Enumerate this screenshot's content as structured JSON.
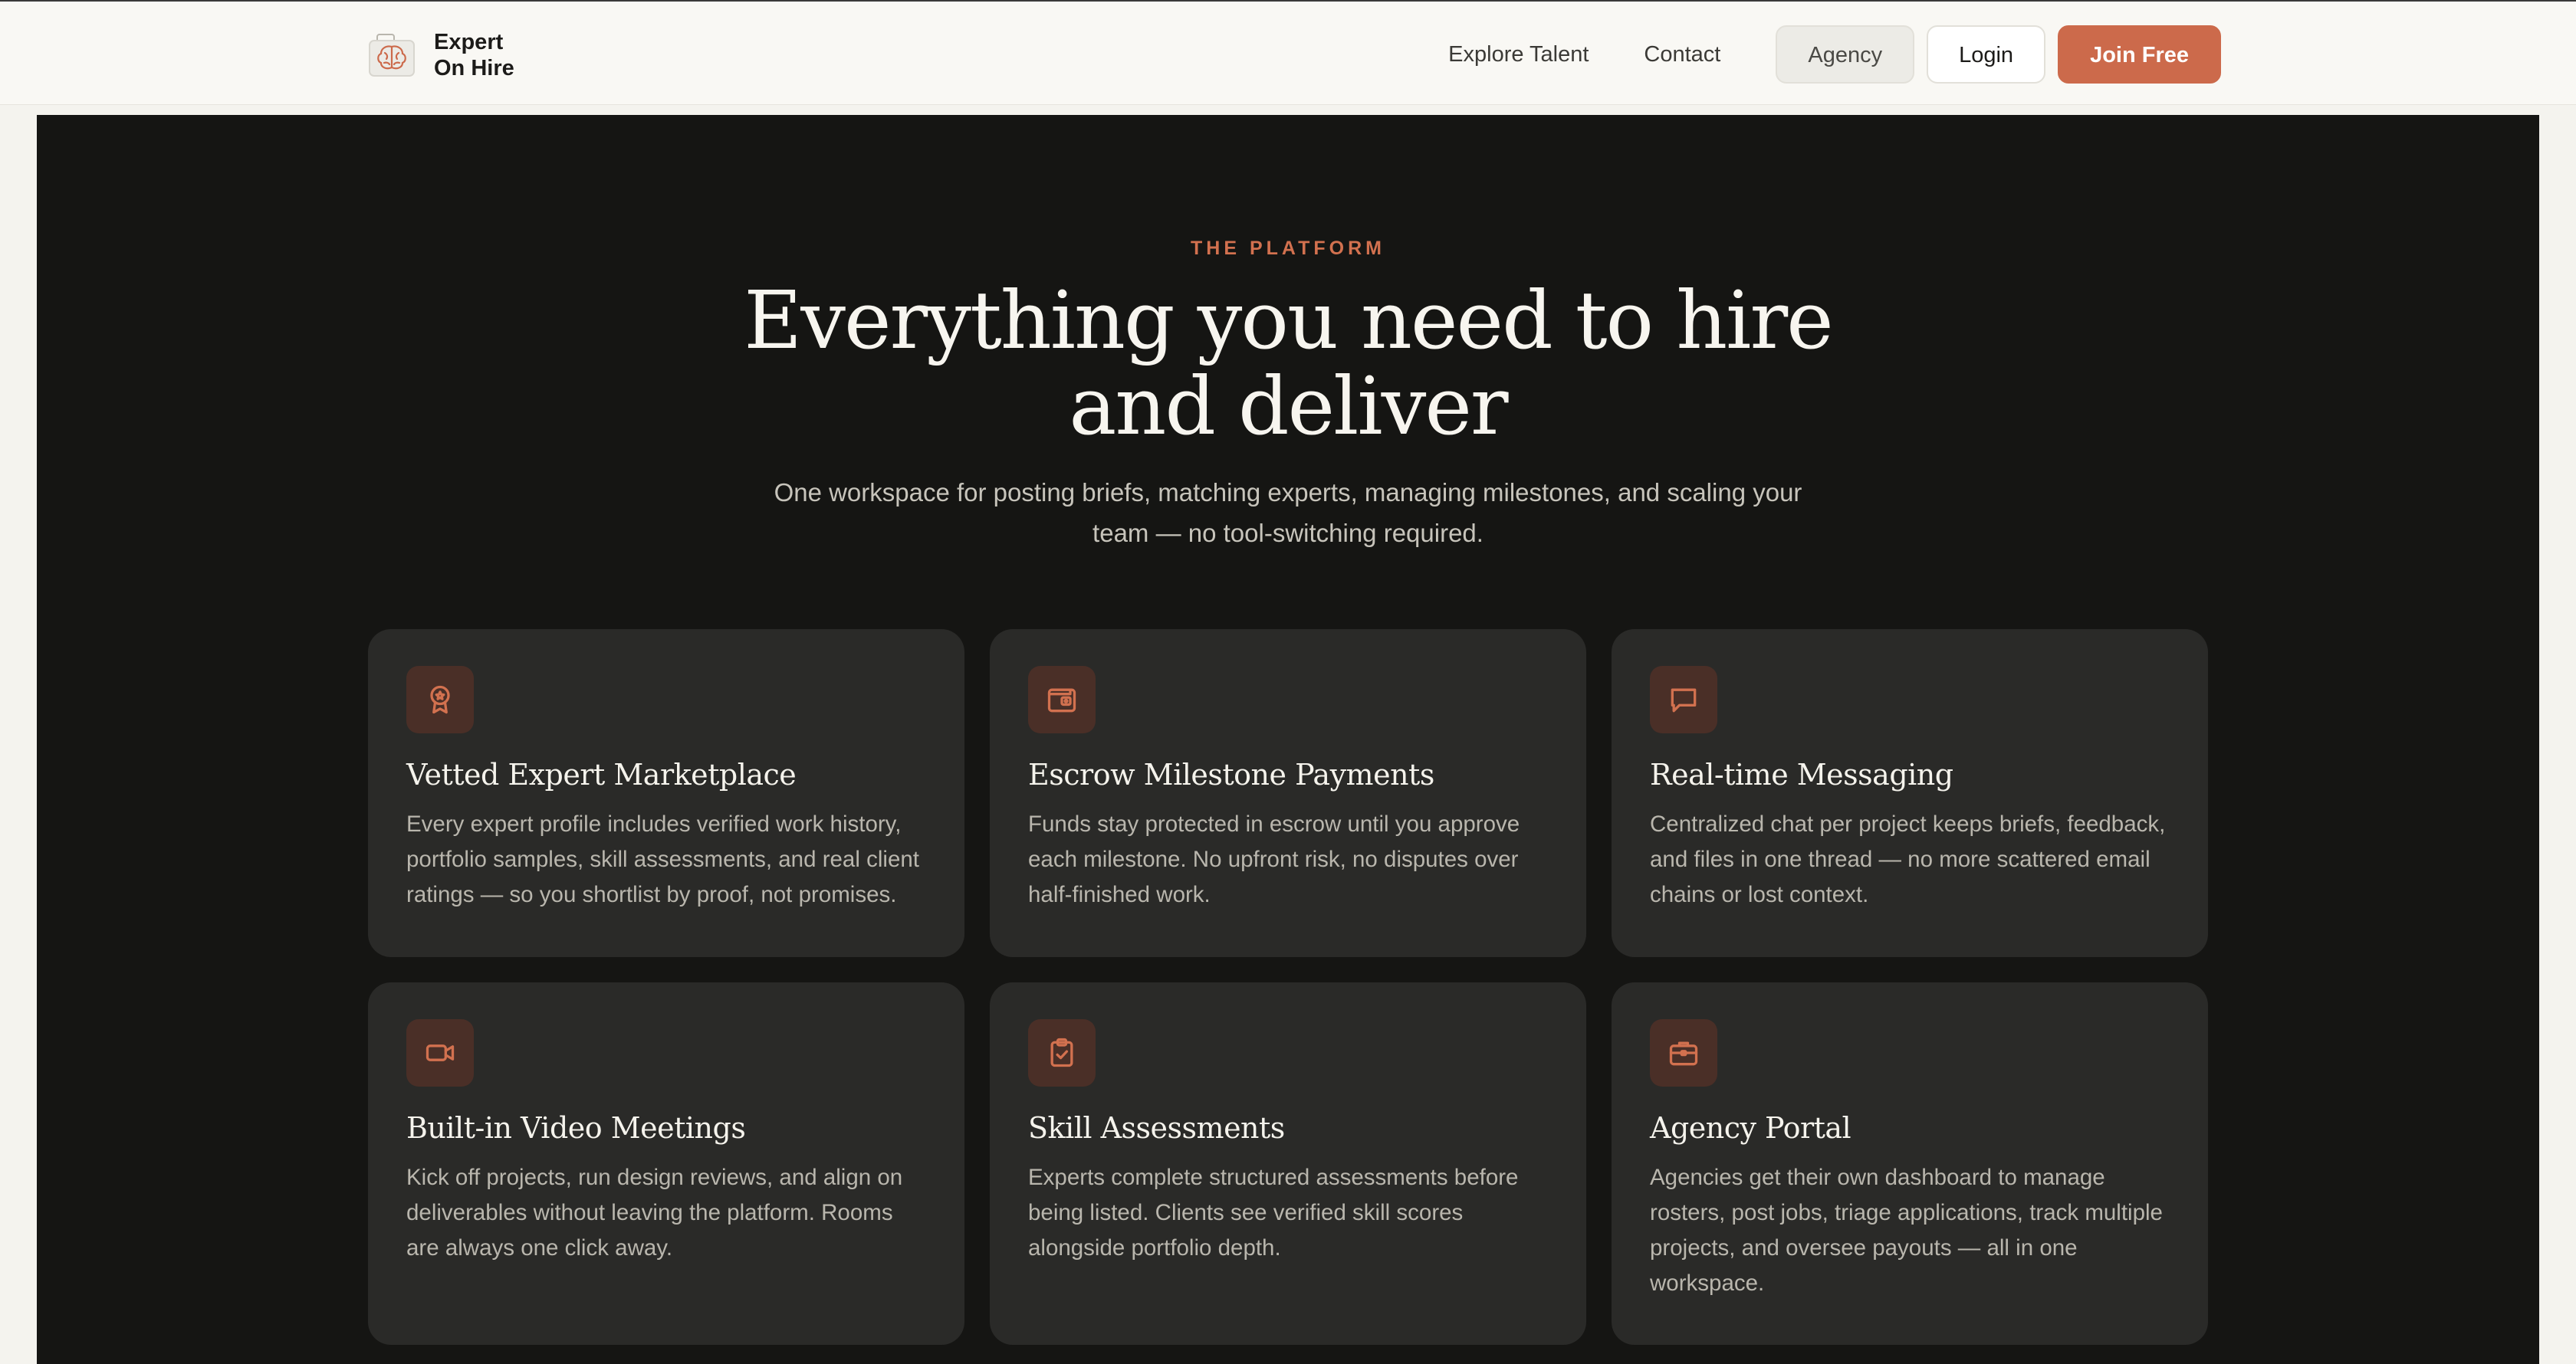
{
  "brand": {
    "line1": "Expert",
    "line2": "On Hire",
    "logo_icon": "brain-icon"
  },
  "nav": {
    "explore_talent": "Explore Talent",
    "contact": "Contact",
    "agency": "Agency",
    "login": "Login",
    "join_free": "Join Free"
  },
  "platform": {
    "eyebrow": "THE PLATFORM",
    "headline_line1": "Everything you need to hire",
    "headline_line2": "and deliver",
    "subhead": "One workspace for posting briefs, matching experts, managing milestones, and scaling your team — no tool-switching required."
  },
  "features": [
    {
      "icon": "award-badge-icon",
      "title": "Vetted Expert Marketplace",
      "body": "Every expert profile includes verified work history, portfolio samples, skill assessments, and real client ratings — so you shortlist by proof, not promises."
    },
    {
      "icon": "wallet-icon",
      "title": "Escrow Milestone Payments",
      "body": "Funds stay protected in escrow until you approve each milestone. No upfront risk, no disputes over half-finished work."
    },
    {
      "icon": "chat-bubble-icon",
      "title": "Real-time Messaging",
      "body": "Centralized chat per project keeps briefs, feedback, and files in one thread — no more scattered email chains or lost context."
    },
    {
      "icon": "video-camera-icon",
      "title": "Built-in Video Meetings",
      "body": "Kick off projects, run design reviews, and align on deliverables without leaving the platform. Rooms are always one click away."
    },
    {
      "icon": "clipboard-check-icon",
      "title": "Skill Assessments",
      "body": "Experts complete structured assessments before being listed. Clients see verified skill scores alongside portfolio depth."
    },
    {
      "icon": "briefcase-icon",
      "title": "Agency Portal",
      "body": "Agencies get their own dashboard to manage rosters, post jobs, triage applications, track multiple projects, and oversee payouts — all in one workspace."
    }
  ],
  "colors": {
    "accent": "#cc6a4b",
    "dark_section": "#151513",
    "card": "#2a2a28",
    "icon_tile": "#4a2f27"
  }
}
